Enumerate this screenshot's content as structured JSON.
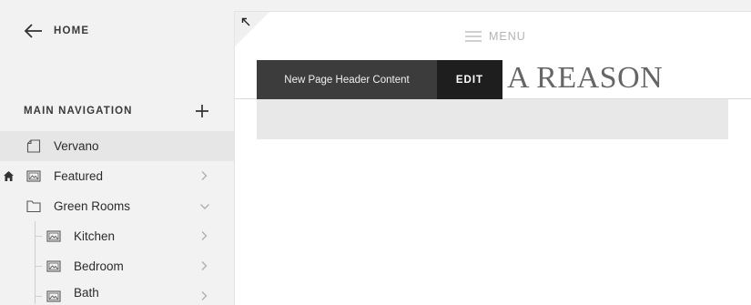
{
  "sidebar": {
    "home_label": "HOME",
    "main_nav_title": "MAIN NAVIGATION",
    "items": [
      {
        "label": "Vervano",
        "icon": "page-icon",
        "selected": true
      },
      {
        "label": "Featured",
        "icon": "gallery-icon",
        "is_homepage": true,
        "chevron": "right"
      },
      {
        "label": "Green Rooms",
        "icon": "folder-icon",
        "chevron": "down"
      },
      {
        "label": "Kitchen",
        "icon": "gallery-icon",
        "chevron": "right"
      },
      {
        "label": "Bedroom",
        "icon": "gallery-icon",
        "chevron": "right"
      },
      {
        "label": "Bath",
        "icon": "gallery-icon",
        "chevron": "right"
      }
    ]
  },
  "canvas": {
    "menu_label": "MENU",
    "header_edit_label": "New Page Header Content",
    "edit_button": "EDIT",
    "site_title": "A REASON"
  },
  "colors": {
    "sidebar_bg": "#f2f2f2",
    "selected_bg": "#e6e6e6",
    "edit_bar_bg": "#3c3c3c",
    "edit_button_bg": "#1e1e1e",
    "site_title": "#666666"
  }
}
